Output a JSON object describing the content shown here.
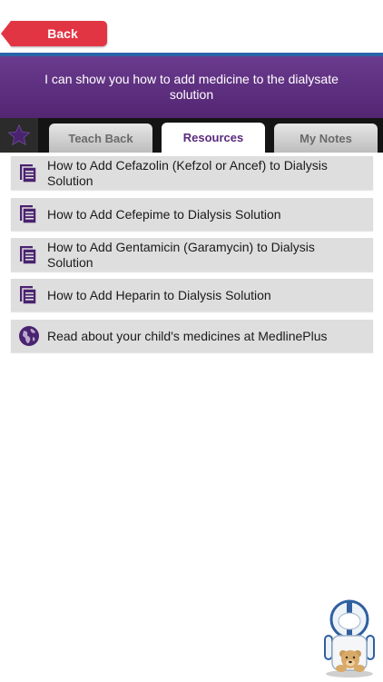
{
  "nav": {
    "back_label": "Back"
  },
  "header": {
    "title": "I can show you how to add medicine to the dialysate solution"
  },
  "tabs": [
    {
      "label": "Teach Back",
      "active": false
    },
    {
      "label": "Resources",
      "active": true
    },
    {
      "label": "My Notes",
      "active": false
    }
  ],
  "resources": [
    {
      "icon": "document-icon",
      "label": "How to Add Cefazolin (Kefzol or Ancef) to Dialysis Solution"
    },
    {
      "icon": "document-icon",
      "label": "How to Add Cefepime to Dialysis Solution"
    },
    {
      "icon": "document-icon",
      "label": "How to Add Gentamicin (Garamycin) to Dialysis Solution"
    },
    {
      "icon": "document-icon",
      "label": "How to Add Heparin to Dialysis Solution"
    },
    {
      "icon": "globe-icon",
      "label": "Read about your child's medicines at MedlinePlus"
    }
  ],
  "colors": {
    "accent_purple": "#5a2a7c",
    "back_red": "#e23544",
    "divider_blue": "#2a63a8"
  }
}
